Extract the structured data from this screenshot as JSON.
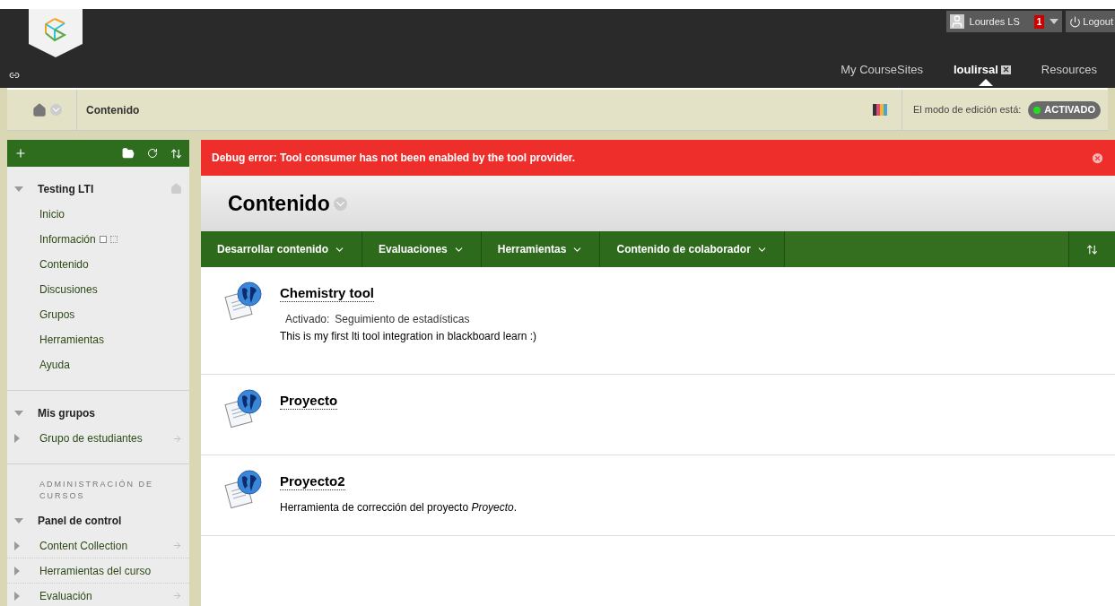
{
  "header": {
    "user": {
      "name": "Lourdes LS",
      "notifications": "1"
    },
    "logout": "Logout",
    "tabs": [
      {
        "label": "My CourseSites",
        "selected": false
      },
      {
        "label": "loulirsal",
        "selected": true
      },
      {
        "label": "Resources",
        "selected": false
      }
    ]
  },
  "breadcrumb": {
    "current": "Contenido",
    "edit_mode": {
      "label": "El modo de edición está:",
      "value": "ACTIVADO",
      "on": true
    }
  },
  "sidebar": {
    "sections": [
      {
        "kind": "course",
        "title": "Testing LTI",
        "expanded": true,
        "items": [
          {
            "label": "Inicio"
          },
          {
            "label": "Información",
            "hidden_marks": true
          },
          {
            "label": "Contenido"
          },
          {
            "label": "Discusiones"
          },
          {
            "label": "Grupos"
          },
          {
            "label": "Herramientas"
          },
          {
            "label": "Ayuda"
          }
        ]
      },
      {
        "kind": "groups",
        "title": "Mis grupos",
        "expanded": true,
        "items": [
          {
            "label": "Grupo de estudiantes",
            "expanded": false,
            "arrow": true
          }
        ]
      },
      {
        "kind": "admin",
        "heading": "ADMINISTRACIÓN DE CURSOS",
        "title": "Panel de control",
        "expanded": true,
        "items": [
          {
            "label": "Content Collection",
            "expanded": false,
            "arrow": true
          },
          {
            "label": "Herramientas del curso",
            "expanded": false,
            "arrow": false
          },
          {
            "label": "Evaluación",
            "expanded": false,
            "arrow": true
          }
        ]
      }
    ]
  },
  "error": "Debug error: Tool consumer has not been enabled by the tool provider.",
  "page_title": "Contenido",
  "action_bar": [
    "Desarrollar contenido",
    "Evaluaciones",
    "Herramientas",
    "Contenido de colaborador"
  ],
  "items": [
    {
      "title": "Chemistry tool",
      "meta_label": "Activado:",
      "meta_value": "Seguimiento de estadísticas",
      "description": "This is my first lti tool integration in blackboard learn :)"
    },
    {
      "title": "Proyecto"
    },
    {
      "title": "Proyecto2",
      "description": "Herramienta de corrección del proyecto *Proyecto*."
    }
  ]
}
